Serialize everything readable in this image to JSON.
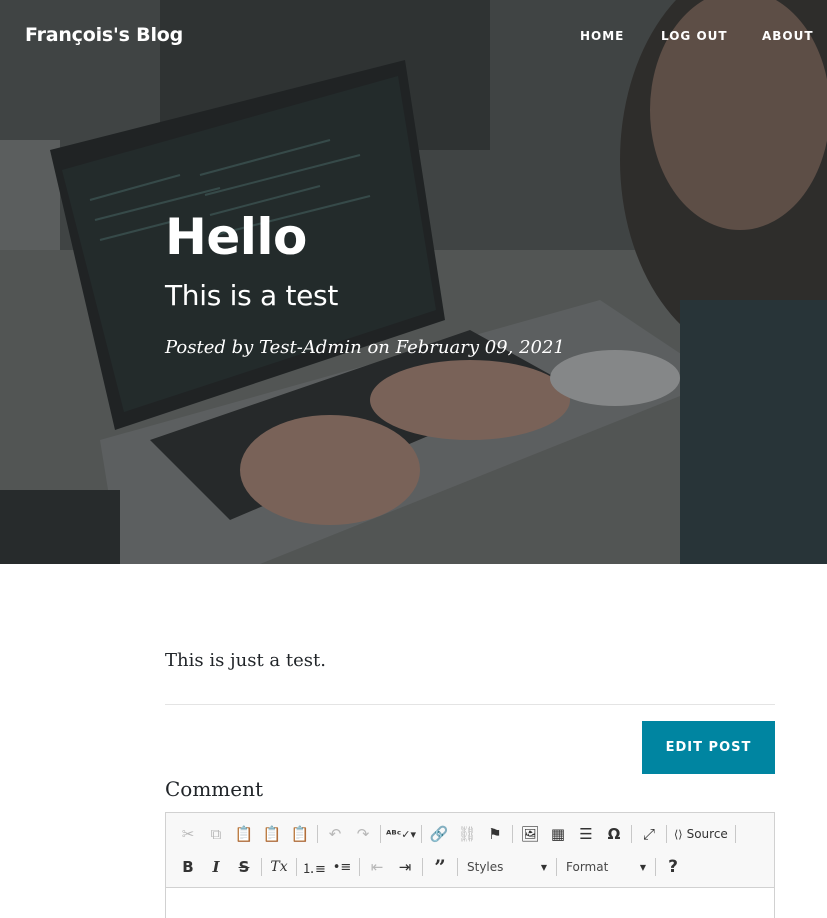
{
  "navbar": {
    "brand": "François's Blog",
    "items": [
      "HOME",
      "LOG OUT",
      "ABOUT"
    ]
  },
  "post": {
    "title": "Hello",
    "subtitle": "This is a test",
    "meta": "Posted by Test-Admin on February 09, 2021",
    "body": "This is just a test."
  },
  "actions": {
    "edit_label": "EDIT POST"
  },
  "comment": {
    "label": "Comment"
  },
  "editor": {
    "toolbar_row1": [
      "cut-icon",
      "copy-icon",
      "paste-icon",
      "paste-text-icon",
      "paste-word-icon",
      "undo-icon",
      "redo-icon",
      "spellcheck-icon",
      "link-icon",
      "unlink-icon",
      "anchor-icon",
      "image-icon",
      "table-icon",
      "horizontal-line-icon",
      "special-char-icon",
      "maximize-icon",
      "source-icon"
    ],
    "source_label": "Source",
    "bold": "B",
    "italic": "I",
    "strike": "S",
    "clear_format": "Tx",
    "styles_label": "Styles",
    "format_label": "Format",
    "help": "?"
  },
  "colors": {
    "accent": "#0085a1",
    "divider": "#e4e4e4"
  }
}
